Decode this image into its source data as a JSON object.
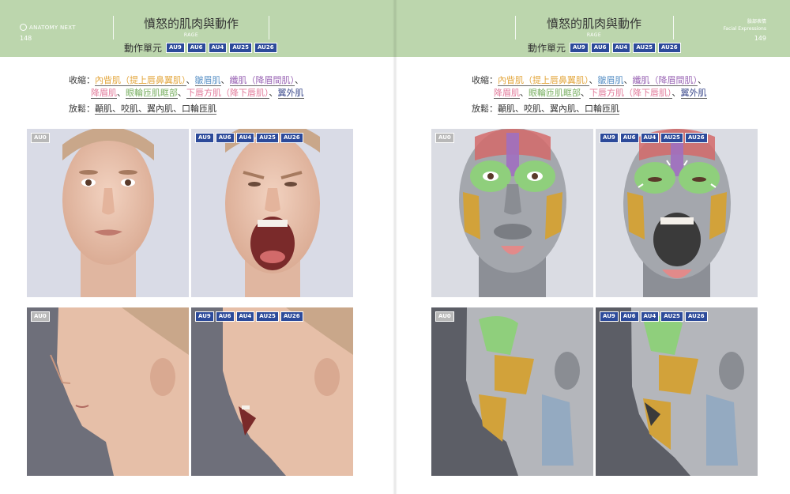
{
  "left_page": {
    "logo": "ANATOMY NEXT",
    "page_number": "148",
    "title": "憤怒的肌肉與動作",
    "subtitle": "RAGE",
    "action_units_label": "動作單元",
    "action_units": [
      "AU9",
      "AU6",
      "AU4",
      "AU25",
      "AU26"
    ],
    "contract_label": "收縮：",
    "contract_line1": [
      {
        "text": "內眥肌（提上唇鼻翼肌）",
        "color": "orange"
      },
      {
        "text": "、",
        "color": "none"
      },
      {
        "text": "皺眉肌",
        "color": "blue"
      },
      {
        "text": "、",
        "color": "none"
      },
      {
        "text": "纖肌（降眉間肌）",
        "color": "purple"
      },
      {
        "text": "、",
        "color": "none"
      }
    ],
    "contract_line2": [
      {
        "text": "降眉肌",
        "color": "pink"
      },
      {
        "text": "、",
        "color": "none"
      },
      {
        "text": "眼輪匝肌眶部",
        "color": "green"
      },
      {
        "text": "、",
        "color": "none"
      },
      {
        "text": "下唇方肌（降下唇肌）",
        "color": "pink"
      },
      {
        "text": "、",
        "color": "none"
      },
      {
        "text": "翼外肌",
        "color": "navy"
      }
    ],
    "relax_label": "放鬆：",
    "relax_text": "顳肌、咬肌、翼內肌、口輪匝肌",
    "panels": [
      {
        "tag": [
          "AU0"
        ]
      },
      {
        "tag": [
          "AU9",
          "AU6",
          "AU4",
          "AU25",
          "AU26"
        ]
      },
      {
        "tag": [
          "AU0"
        ]
      },
      {
        "tag": [
          "AU9",
          "AU6",
          "AU4",
          "AU25",
          "AU26"
        ]
      }
    ]
  },
  "right_page": {
    "top_right_line1": "臉部表情",
    "top_right_line2": "Facial Expressions",
    "page_number": "149",
    "title": "憤怒的肌肉與動作",
    "subtitle": "RAGE",
    "action_units_label": "動作單元",
    "action_units": [
      "AU9",
      "AU6",
      "AU4",
      "AU25",
      "AU26"
    ],
    "contract_label": "收縮：",
    "relax_label": "放鬆：",
    "relax_text": "顳肌、咬肌、翼內肌、口輪匝肌",
    "panels": [
      {
        "tag": [
          "AU0"
        ]
      },
      {
        "tag": [
          "AU9",
          "AU6",
          "AU4",
          "AU25",
          "AU26"
        ]
      },
      {
        "tag": [
          "AU0"
        ]
      },
      {
        "tag": [
          "AU9",
          "AU6",
          "AU4",
          "AU25",
          "AU26"
        ]
      }
    ]
  },
  "colors": {
    "header_green": "#bcd6ad",
    "badge_blue": "#2c4a9a",
    "orange": "#e3a53a",
    "blue": "#5c93c7",
    "purple": "#9a65b5",
    "green": "#7ab063",
    "pink": "#e27a9a",
    "navy": "#3c4a8c"
  }
}
